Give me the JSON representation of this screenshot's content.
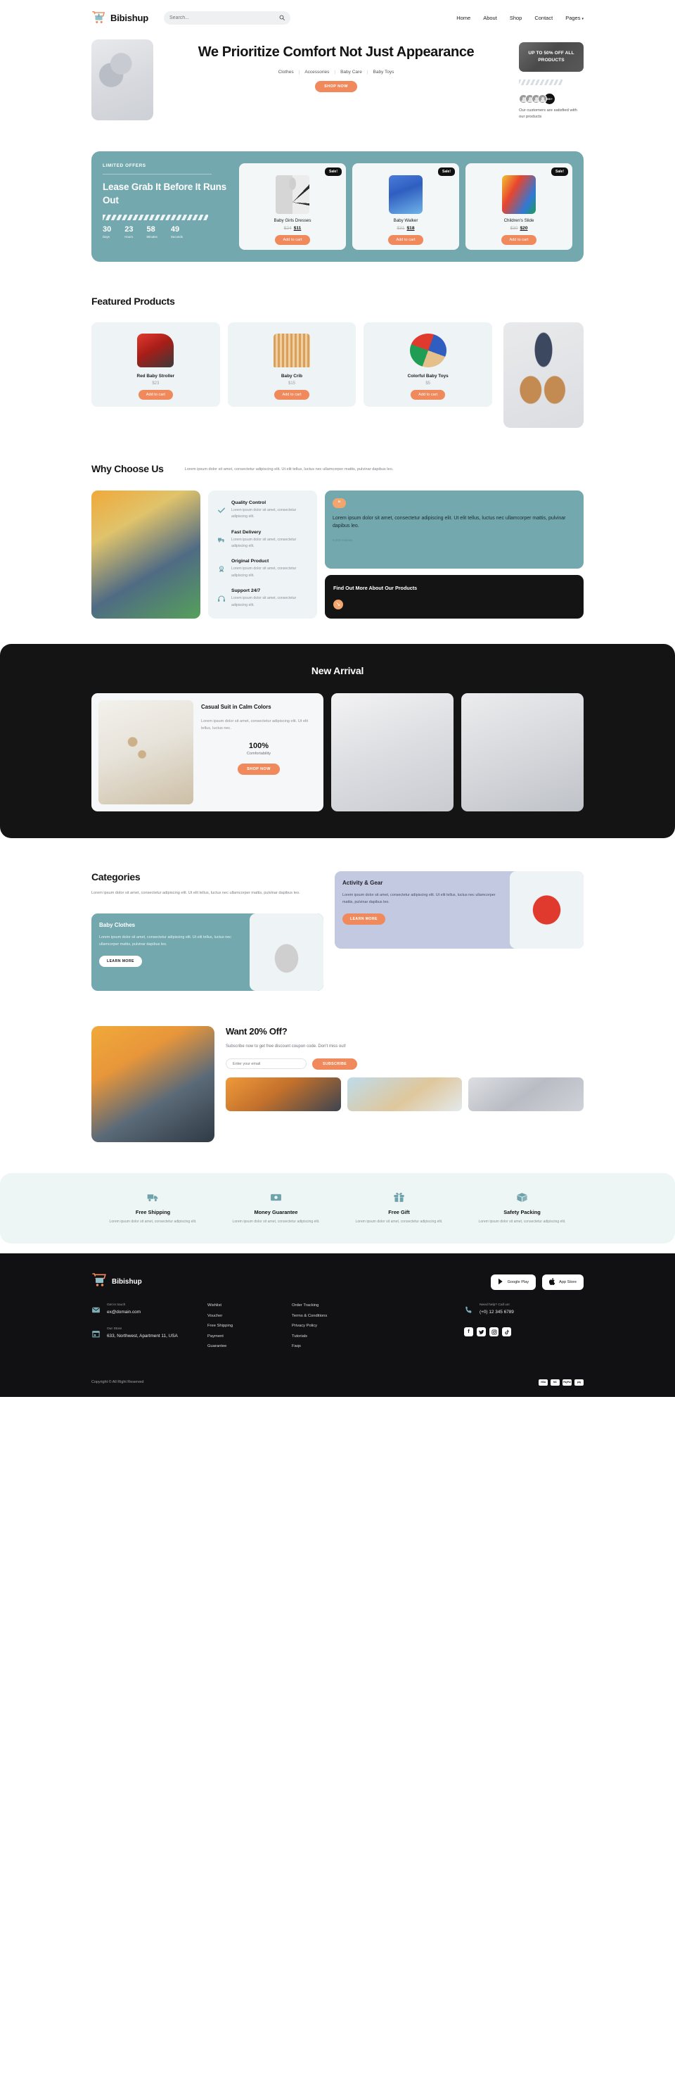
{
  "brand": {
    "name": "Bibishup"
  },
  "header": {
    "search": {
      "placeholder": "Search...",
      "value": ""
    },
    "nav": [
      {
        "label": "Home"
      },
      {
        "label": "About"
      },
      {
        "label": "Shop"
      },
      {
        "label": "Contact"
      },
      {
        "label": "Pages",
        "caret": "▾"
      }
    ]
  },
  "hero": {
    "title": "We Prioritize Comfort Not Just Appearance",
    "links": [
      "Clothes",
      "Accessories",
      "Baby Care",
      "Baby Toys"
    ],
    "cta": "SHOP NOW",
    "promo": "UP TO 50% OFF ALL PRODUCTS",
    "avatar_count": "50K+",
    "avatar_caption": "Our customers are satisfied with our products"
  },
  "offers": {
    "kicker": "LIMITED OFFERS",
    "title": "Lease Grab It Before It Runs Out",
    "countdown": [
      {
        "num": "30",
        "label": "Days"
      },
      {
        "num": "23",
        "label": "Hours"
      },
      {
        "num": "58",
        "label": "Minutes"
      },
      {
        "num": "49",
        "label": "Seconds"
      }
    ],
    "products": [
      {
        "badge": "Sale!",
        "name": "Baby Girls Dresses",
        "old": "$24",
        "new": "$11",
        "cta": "Add to cart"
      },
      {
        "badge": "Sale!",
        "name": "Baby Walker",
        "old": "$31",
        "new": "$18",
        "cta": "Add to cart"
      },
      {
        "badge": "Sale!",
        "name": "Children's Slide",
        "old": "$30",
        "new": "$20",
        "cta": "Add to cart"
      }
    ]
  },
  "featured": {
    "title": "Featured Products",
    "products": [
      {
        "name": "Red Baby Stroller",
        "price": "$23",
        "cta": "Add to cart"
      },
      {
        "name": "Baby Crib",
        "price": "$15",
        "cta": "Add to cart"
      },
      {
        "name": "Colorful Baby Toys",
        "price": "$5",
        "cta": "Add to cart"
      }
    ]
  },
  "why": {
    "title": "Why Choose Us",
    "subtitle": "Lorem ipsum dolor sit amet, consectetur adipiscing elit. Ut elit tellus, luctus nec ullamcorper mattis, pulvinar dapibus leo.",
    "items": [
      {
        "icon": "check-icon",
        "title": "Quality Control",
        "desc": "Lorem ipsum dolor sit amet, consectetur adipiscing elit."
      },
      {
        "icon": "truck-icon",
        "title": "Fast Delivery",
        "desc": "Lorem ipsum dolor sit amet, consectetur adipiscing elit."
      },
      {
        "icon": "medal-icon",
        "title": "Original Product",
        "desc": "Lorem ipsum dolor sit amet, consectetur adipiscing elit."
      },
      {
        "icon": "headset-icon",
        "title": "Support 24/7",
        "desc": "Lorem ipsum dolor sit amet, consectetur adipiscing elit."
      }
    ],
    "quote": {
      "mark": "“",
      "text": "Lorem ipsum dolor sit amet, consectetur adipiscing elit. Ut elit tellus, luctus nec ullamcorper mattis, pulvinar dapibus leo.",
      "reviews": "5,000 reviews"
    },
    "more": {
      "title": "Find Out More About Our Products",
      "arrow": "↘"
    }
  },
  "arrival": {
    "title": "New Arrival",
    "main": {
      "title": "Casual Suit in Calm Colors",
      "desc": "Lorem ipsum dolor sit amet, consectetur adipiscing elit. Ut elit tellus, luctus nec.",
      "percent": "100%",
      "percent_label": "Comfortability",
      "cta": "SHOP NOW"
    }
  },
  "categories": {
    "title": "Categories",
    "desc": "Lorem ipsum dolor sit amet, consectetur adipiscing elit. Ut elit tellus, luctus nec ullamcorper mattis, pulvinar dapibus leo.",
    "baby_clothes": {
      "title": "Baby Clothes",
      "desc": "Lorem ipsum dolor sit amet, consectetur adipiscing elit. Ut elit tellus, luctus nec ullamcorper mattis, pulvinar dapibus leo.",
      "cta": "LEARN MORE"
    },
    "activity_gear": {
      "title": "Activity & Gear",
      "desc": "Lorem ipsum dolor sit amet, consectetur adipiscing elit. Ut elit tellus, luctus nec ullamcorper mattis, pulvinar dapibus leo.",
      "cta": "LEARN MORE"
    }
  },
  "newsletter": {
    "title": "Want 20% Off?",
    "desc": "Subscribe now to get free discount coupon code. Don't miss out!",
    "placeholder": "Enter your email",
    "value": "",
    "cta": "SUBSCRIBE"
  },
  "services": [
    {
      "icon": "truck-icon",
      "title": "Free Shipping",
      "desc": "Lorem ipsum dolor sit amet, consectetur adipiscing elit."
    },
    {
      "icon": "money-icon",
      "title": "Money Guarantee",
      "desc": "Lorem ipsum dolor sit amet, consectetur adipiscing elit."
    },
    {
      "icon": "gift-icon",
      "title": "Free Gift",
      "desc": "Lorem ipsum dolor sit amet, consectetur adipiscing elit."
    },
    {
      "icon": "box-icon",
      "title": "Safety Packing",
      "desc": "Lorem ipsum dolor sit amet, consectetur adipiscing elit."
    }
  ],
  "footer": {
    "stores": [
      {
        "icon": "google-play-icon",
        "label": "Google Play"
      },
      {
        "icon": "apple-icon",
        "label": "App Store"
      }
    ],
    "contact": [
      {
        "icon": "mail-icon",
        "label": "Get in touch",
        "value": "ex@domain.com"
      },
      {
        "icon": "store-icon",
        "label": "Our Store",
        "value": "633, Northwest, Apartment 11, USA"
      }
    ],
    "links_col1": [
      "Wishlist",
      "Voucher",
      "Free Shipping",
      "Payment",
      "Guarantee"
    ],
    "links_col2": [
      "Order Tracking",
      "Terms & Conditions",
      "Privacy Policy",
      "Tutorials",
      "Faqs"
    ],
    "help": {
      "icon": "phone-icon",
      "label": "Need help? Call us!",
      "value": "(+0) 12 345 6789"
    },
    "social": [
      {
        "name": "facebook-icon",
        "glyph": "f"
      },
      {
        "name": "twitter-icon",
        "glyph": "ᴠ"
      },
      {
        "name": "instagram-icon",
        "glyph": "□"
      },
      {
        "name": "tiktok-icon",
        "glyph": "♪"
      }
    ],
    "copyright": "Copyright © All Right Reserved",
    "payments": [
      "VISA",
      "MC",
      "PayPal",
      "pay"
    ]
  },
  "colors": {
    "accent": "#F08A5D",
    "teal": "#72A8AE",
    "dark": "#141414",
    "lav": "#c3c9e0"
  }
}
